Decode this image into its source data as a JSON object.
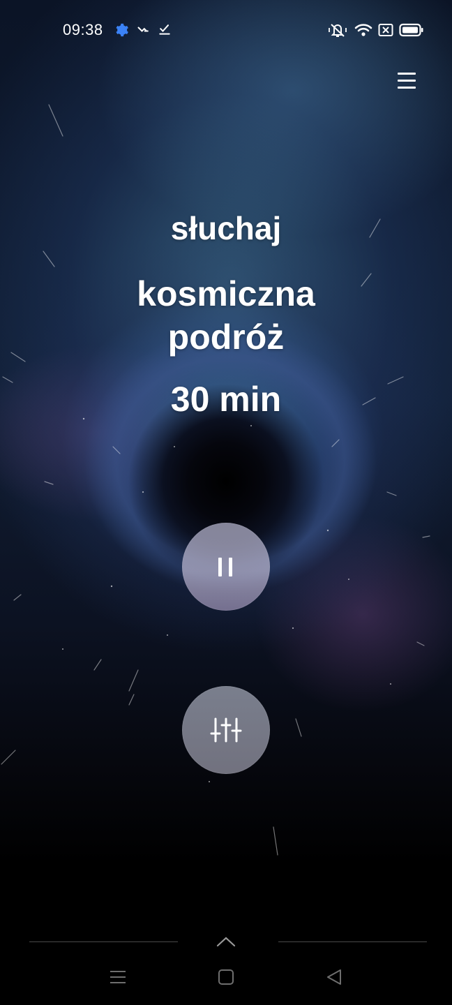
{
  "status_bar": {
    "time": "09:38",
    "left_icons": [
      "gear-icon",
      "missed-call-icon",
      "download-check-icon"
    ],
    "right_icons": [
      "vibrate-icon",
      "wifi-icon",
      "close-box-icon",
      "battery-icon"
    ],
    "gear_color": "#3b82f6"
  },
  "header": {
    "menu_icon": "hamburger-menu-icon"
  },
  "session": {
    "mode": "słuchaj",
    "name": "kosmiczna podróż",
    "duration": "30 min"
  },
  "controls": {
    "pause_icon": "pause-icon",
    "mixer_icon": "sliders-icon"
  },
  "navigation": {
    "swipe_up_icon": "chevron-up-icon",
    "buttons": [
      "recents-icon",
      "home-icon",
      "back-icon"
    ]
  }
}
